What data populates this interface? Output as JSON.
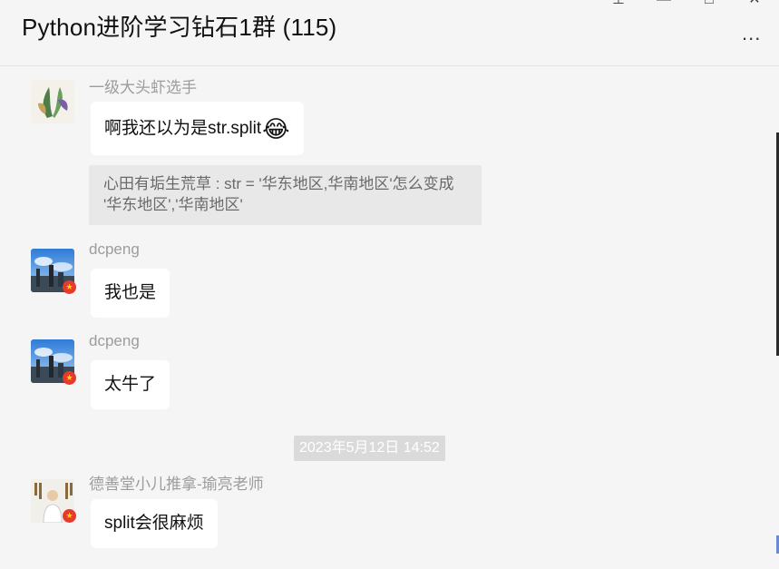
{
  "window": {
    "title": "Python进阶学习钻石1群 (115)",
    "pin_icon": "pin-icon",
    "minimize_icon": "minimize-icon",
    "maximize_icon": "maximize-icon",
    "close_icon": "close-icon",
    "more_label": "...",
    "pin_glyph": "⊥",
    "min_glyph": "—",
    "max_glyph": "□",
    "close_glyph": "✕"
  },
  "messages": [
    {
      "sender": "一级大头虾选手",
      "text": "啊我还以为是str.split",
      "emoji": "😂",
      "quote": "心田有垢生荒草 : str = '华东地区,华南地区'怎么变成 '华东地区','华南地区'"
    },
    {
      "sender": "dcpeng",
      "text": "我也是"
    },
    {
      "sender": "dcpeng",
      "text": "太牛了"
    },
    {
      "sender": "德善堂小儿推拿-瑜亮老师",
      "text": "split会很麻烦"
    }
  ],
  "timestamp": "2023年5月12日 14:52",
  "colors": {
    "bubble": "#ffffff",
    "background": "#f5f5f5",
    "quote_bg": "#e8e8e8",
    "flag": "#e63a2d"
  }
}
